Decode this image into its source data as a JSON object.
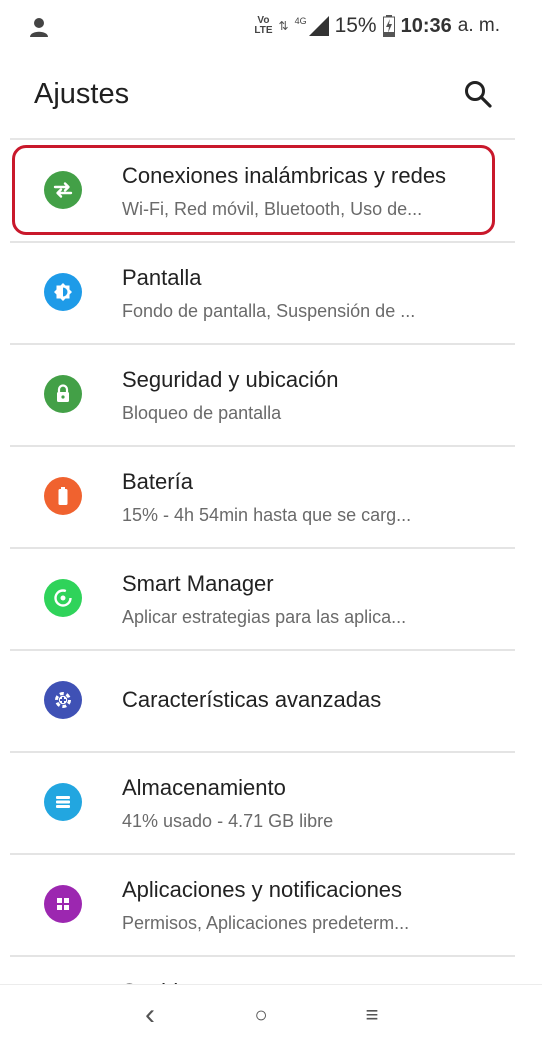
{
  "status_bar": {
    "volte_top": "Vo",
    "volte_bottom": "LTE",
    "data_arrows": "⇅",
    "network": "4G",
    "battery_percent": "15%",
    "time": "10:36",
    "ampm": "a. m."
  },
  "header": {
    "title": "Ajustes",
    "search_icon": "search-icon"
  },
  "settings": [
    {
      "title": "Conexiones inalámbricas y redes",
      "subtitle": "Wi-Fi, Red móvil, Bluetooth, Uso de...",
      "icon": "swap-arrows-icon",
      "color": "#43a047",
      "highlighted": true
    },
    {
      "title": "Pantalla",
      "subtitle": "Fondo de pantalla, Suspensión de ...",
      "icon": "brightness-icon",
      "color": "#1e9be8"
    },
    {
      "title": "Seguridad y ubicación",
      "subtitle": "Bloqueo de pantalla",
      "icon": "lock-icon",
      "color": "#43a047"
    },
    {
      "title": "Batería",
      "subtitle": "15% - 4h 54min hasta que se carg...",
      "icon": "battery-icon",
      "color": "#f0622f"
    },
    {
      "title": "Smart Manager",
      "subtitle": "Aplicar estrategias para las aplica...",
      "icon": "smart-manager-icon",
      "color": "#2fd35a"
    },
    {
      "title": "Características avanzadas",
      "subtitle": "",
      "icon": "advanced-features-icon",
      "color": "#3f51b5"
    },
    {
      "title": "Almacenamiento",
      "subtitle": "41% usado - 4.71 GB libre",
      "icon": "storage-icon",
      "color": "#22a6e0"
    },
    {
      "title": "Aplicaciones y notificaciones",
      "subtitle": "Permisos, Aplicaciones predeterm...",
      "icon": "apps-icon",
      "color": "#9c27b0"
    },
    {
      "title": "Sonido",
      "subtitle": "",
      "icon": "sound-icon",
      "color": "#d12fb2"
    }
  ],
  "nav_bar": {
    "back": "‹",
    "home": "○",
    "recents": "≡"
  }
}
